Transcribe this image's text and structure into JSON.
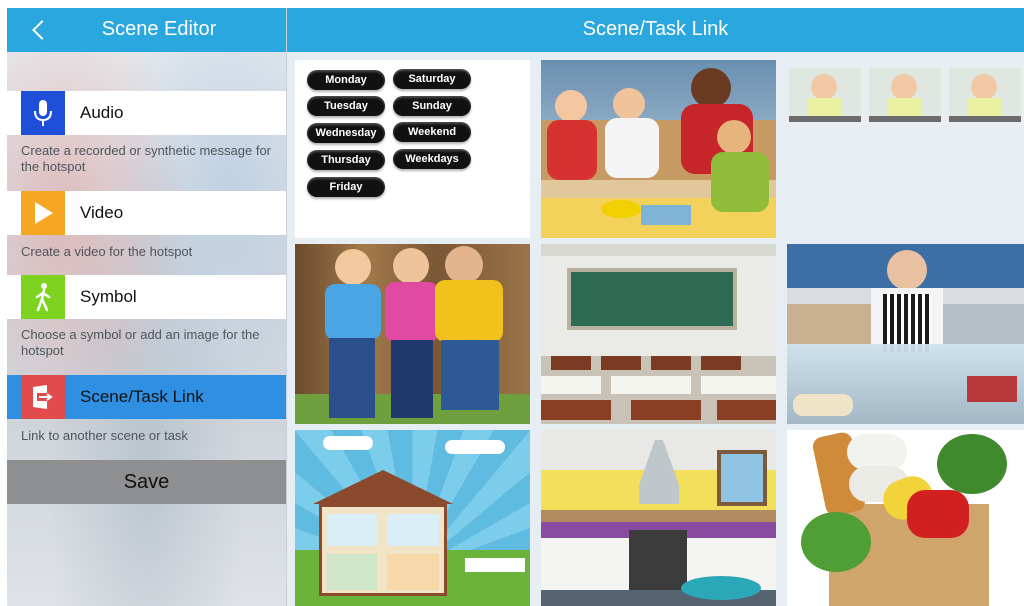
{
  "left_header": {
    "title": "Scene Editor"
  },
  "options": [
    {
      "name": "audio",
      "label": "Audio",
      "description": "Create a  recorded or synthetic message for the hotspot",
      "icon": "microphone-icon",
      "color": "#1f4fd8"
    },
    {
      "name": "video",
      "label": "Video",
      "description": "Create a video for the hotspot",
      "icon": "play-icon",
      "color": "#f5a623"
    },
    {
      "name": "symbol",
      "label": "Symbol",
      "description": "Choose a symbol or add an image for the hotspot",
      "icon": "walking-person-icon",
      "color": "#7ed321"
    },
    {
      "name": "scene-task-link",
      "label": "Scene/Task Link",
      "description": "Link to another scene or task",
      "icon": "door-link-icon",
      "color": "#e24b4b",
      "selected": true
    }
  ],
  "save_label": "Save",
  "right_header": {
    "title": "Scene/Task Link"
  },
  "days": [
    "Monday",
    "Saturday",
    "Tuesday",
    "Sunday",
    "Wednesday",
    "Weekend",
    "Thursday",
    "Weekdays",
    "Friday"
  ],
  "tiles": [
    {
      "name": "days-of-week"
    },
    {
      "name": "children-playing-at-table"
    },
    {
      "name": "toothbrushing-steps"
    },
    {
      "name": "children-on-playground"
    },
    {
      "name": "empty-classroom"
    },
    {
      "name": "deli-counter"
    },
    {
      "name": "house-cutaway"
    },
    {
      "name": "kitchen"
    },
    {
      "name": "grocery-bag"
    }
  ],
  "accent": "#2aa7df"
}
